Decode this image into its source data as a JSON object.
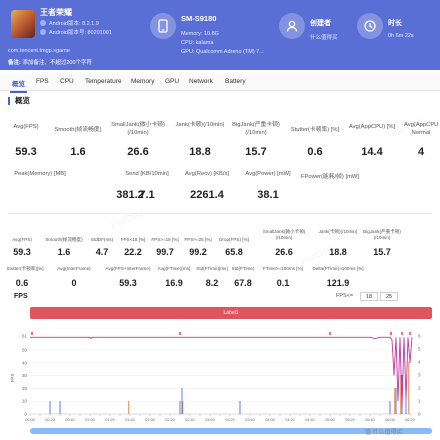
{
  "app": {
    "name": "王者荣耀",
    "android_version": "Android版本: 8.2.1.9",
    "android_code": "Android版本号: 80201001",
    "package": "com.tencent.tmgp.sgame"
  },
  "device": {
    "name": "SM-S9180",
    "memory": "Memory: 10.8G",
    "cpu": "CPU: kalama",
    "gpu": "GPU: Qualcomm Adreno (TM) 7..."
  },
  "creator": {
    "title": "创建者",
    "sub": "什么值得买"
  },
  "duration": {
    "title": "时长",
    "sub": "0h 6m 22s"
  },
  "notice": {
    "label": "备注:",
    "text": "添加备注、不超过200个字符"
  },
  "tabs": [
    "概览",
    "FPS",
    "CPU",
    "Temperature",
    "Memory",
    "GPU",
    "Network",
    "Battery"
  ],
  "section_title": "概览",
  "overview_row1": [
    {
      "label": "Avg(FPS)",
      "value": "59.3"
    },
    {
      "label": "Smooth(帧流畅度)",
      "value": "1.6"
    },
    {
      "label": "SmallJank(微小卡顿)(/10min)",
      "value": "26.6"
    },
    {
      "label": "Jank(卡顿)(/10min)",
      "value": "18.8"
    },
    {
      "label": "BigJank(严重卡顿)(/10min)",
      "value": "15.7"
    },
    {
      "label": "Stutter(卡顿率) [%]",
      "value": "0.6"
    },
    {
      "label": "Avg(AppCPU) [%]",
      "value": "14.4"
    },
    {
      "label": "Avg(AppCPU) Normal",
      "value": "4"
    }
  ],
  "overview_row2": [
    {
      "label": "Peak(Memory) [MB]",
      "value": "381.2"
    },
    {
      "label": "Send [KB/10min]",
      "value": "7.1"
    },
    {
      "label": "Avg(Recv) [KB/s]",
      "value": "2261.4"
    },
    {
      "label": "Avg(Power) [mW]",
      "value": "38.1"
    },
    {
      "label": "FPower(能耗/帧) [mW]",
      "value": ""
    }
  ],
  "detail_row1": [
    {
      "label": "Avg(FPS)",
      "value": "59.3"
    },
    {
      "label": "Smooth(帧流畅度)",
      "value": "1.6"
    },
    {
      "label": "StdDF(ms)",
      "value": "4.7"
    },
    {
      "label": "FPS<18 [%]",
      "value": "22.2"
    },
    {
      "label": "FPS>=18 [%]",
      "value": "99.7"
    },
    {
      "label": "FPS>=25 [%]",
      "value": "99.2"
    },
    {
      "label": "Drop(FPS) [%]",
      "value": "65.8"
    },
    {
      "label": "SmallJank(微小卡顿)(/10min)",
      "value": "26.6"
    },
    {
      "label": "Jank(卡顿)(/10min)",
      "value": "18.8"
    },
    {
      "label": "BigJank(严重卡顿)(/10min)",
      "value": "15.7"
    }
  ],
  "detail_row2": [
    {
      "label": "Stutter(卡顿率)[%]",
      "value": "0.6"
    },
    {
      "label": "Avg(InterFrame)",
      "value": "0"
    },
    {
      "label": "Avg(FPS+InterFrame)",
      "value": "59.3"
    },
    {
      "label": "Avg(FTime)[ms]",
      "value": "16.9"
    },
    {
      "label": "Std(FTime)[ms]",
      "value": "8.2"
    },
    {
      "label": "Std(FTime)",
      "value": "67.8"
    },
    {
      "label": "FTime>=100ms [%]",
      "value": "0.1"
    },
    {
      "label": "Delta(FTime)>100ms [%]",
      "value": "121.9"
    }
  ],
  "fps_panel": {
    "title": "FPS",
    "threshold_label": "FPS<=",
    "threshold_a": "18",
    "threshold_b": "25",
    "bar_label": "Label1"
  },
  "site_watermark": "值 什么值得买",
  "colors": {
    "header": "#5a6fd6",
    "accent": "#4a5fd0",
    "fps_line": "#c0399f",
    "jank": "#4a6fe0",
    "bigjank": "#e07a2c",
    "marker": "#e0545d"
  },
  "chart_data": {
    "type": "line",
    "title": "FPS",
    "xlabel": "",
    "ylabel": "FPS",
    "ylim": [
      0,
      61
    ],
    "yticks": [
      0,
      10,
      20,
      30,
      40,
      50,
      61
    ],
    "y2label": "",
    "y2ticks": [
      0,
      1,
      2,
      3,
      4,
      5,
      6
    ],
    "x_ticks": [
      "00:00",
      "00:10",
      "00:20",
      "00:30",
      "00:40",
      "00:50",
      "01:00",
      "01:10",
      "01:20",
      "01:30",
      "01:40",
      "01:50",
      "02:00",
      "02:10",
      "02:20",
      "02:30",
      "02:40",
      "02:50",
      "03:00",
      "03:10",
      "03:20",
      "03:30",
      "03:40",
      "03:50",
      "04:00",
      "04:10",
      "04:20",
      "04:30",
      "04:40",
      "04:50",
      "05:00",
      "05:10",
      "05:20",
      "05:30",
      "05:40",
      "05:50",
      "06:00",
      "06:10",
      "06:20"
    ],
    "series": [
      {
        "name": "FPS",
        "x": [
          0,
          60,
          61,
          62,
          120,
          200,
          260,
          300,
          340,
          345,
          350,
          360,
          362,
          364,
          366,
          368,
          370,
          372,
          374,
          376,
          378,
          380,
          382
        ],
        "values": [
          60,
          60,
          59,
          60,
          60,
          60,
          60,
          60,
          60,
          59,
          60,
          60,
          58,
          30,
          60,
          10,
          60,
          5,
          60,
          12,
          60,
          40,
          60
        ]
      },
      {
        "name": "Jank",
        "x": [
          20,
          30,
          150,
          152,
          210,
          360,
          366,
          372,
          376
        ],
        "values": [
          1,
          1,
          1,
          2,
          1,
          1,
          2,
          3,
          2
        ]
      },
      {
        "name": "BigJank",
        "x": [
          98,
          152,
          364,
          370,
          378
        ],
        "values": [
          1,
          1,
          2,
          3,
          4
        ]
      }
    ]
  }
}
